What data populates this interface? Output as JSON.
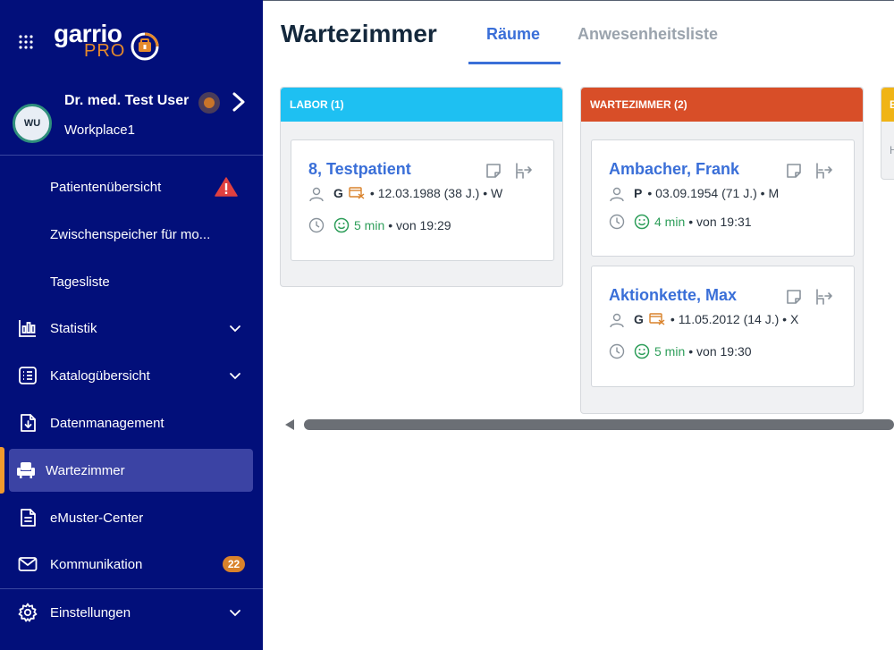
{
  "sidebar": {
    "logo": {
      "brand": "garrio",
      "product": "PRO"
    },
    "user": {
      "initials": "WU",
      "name": "Dr. med. Test User",
      "workplace": "Workplace1",
      "status_color": "#c8742a"
    },
    "items": [
      {
        "label": "Patientenübersicht",
        "icon": "warning-icon"
      },
      {
        "label": "Zwischenspeicher für mo..."
      },
      {
        "label": "Tagesliste"
      },
      {
        "label": "Statistik",
        "icon": "chart-icon"
      },
      {
        "label": "Katalogübersicht",
        "icon": "list-icon"
      },
      {
        "label": "Datenmanagement",
        "icon": "file-download-icon"
      },
      {
        "label": "Wartezimmer",
        "icon": "armchair-icon",
        "active": true
      },
      {
        "label": "eMuster-Center",
        "icon": "document-icon"
      },
      {
        "label": "Kommunikation",
        "icon": "mail-icon",
        "badge": "22"
      },
      {
        "label": "Einstellungen",
        "icon": "gear-icon"
      }
    ],
    "accent_color": "#f09a2e",
    "background_color": "#020f7a"
  },
  "main": {
    "title": "Wartezimmer",
    "tabs": [
      {
        "label": "Räume",
        "active": true
      },
      {
        "label": "Anwesenheitsliste",
        "active": false
      }
    ],
    "columns": [
      {
        "header": "LABOR (1)",
        "color": "#1ec0f2",
        "cards": [
          {
            "name": "8, Testpatient",
            "insurance": "G",
            "dob": "12.03.1988 (38 J.)",
            "sex": "W",
            "wait": "5 min",
            "since": "von 19:29"
          }
        ]
      },
      {
        "header": "WARTEZIMMER (2)",
        "color": "#d84e28",
        "cards": [
          {
            "name": "Ambacher, Frank",
            "insurance": "P",
            "dob": "03.09.1954 (71 J.)",
            "sex": "M",
            "wait": "4 min",
            "since": "von 19:31"
          },
          {
            "name": "Aktionkette, Max",
            "insurance": "G",
            "dob": "11.05.2012 (14 J.)",
            "sex": "X",
            "wait": "5 min",
            "since": "von 19:30"
          }
        ]
      },
      {
        "header": "B",
        "color": "#f0b416",
        "cards": [],
        "partial_text": "H"
      }
    ]
  }
}
